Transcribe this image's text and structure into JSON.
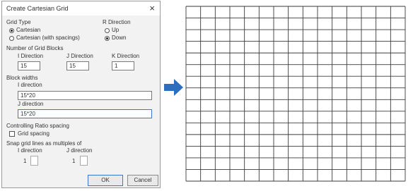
{
  "dialog": {
    "title": "Create Cartesian Grid",
    "grid_type": {
      "label": "Grid Type",
      "options": [
        "Cartesian",
        "Cartesian (with spacings)"
      ],
      "selected": "Cartesian"
    },
    "r_direction": {
      "label": "R Direction",
      "options": [
        "Up",
        "Down"
      ],
      "selected": "Down"
    },
    "number_of_grid_blocks": {
      "label": "Number of Grid Blocks",
      "i_label": "I Direction",
      "j_label": "J Direction",
      "k_label": "K Direction",
      "i_value": "15",
      "j_value": "15",
      "k_value": "1"
    },
    "block_widths": {
      "label": "Block widths",
      "i_label": "I direction",
      "i_value": "15*20",
      "j_label": "J direction",
      "j_value": "15*20"
    },
    "controlling_ratio": {
      "label": "Controlling Ratio spacing",
      "checkbox_label": "Grid spacing"
    },
    "snap_grid": {
      "label": "Snap grid lines as multiples of",
      "i_label": "I direction",
      "j_label": "J direction",
      "i_value": "1",
      "j_value": "1"
    },
    "ok_label": "OK",
    "cancel_label": "Cancel"
  },
  "grid_preview": {
    "columns": 15,
    "rows": 15,
    "line_color": "#3a3a3a",
    "arrow_color": "#2e6fbd"
  }
}
